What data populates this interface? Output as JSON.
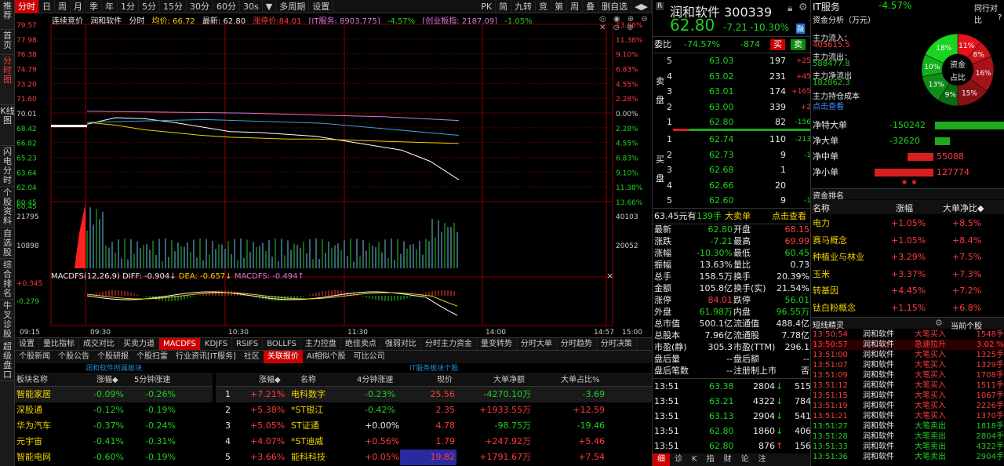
{
  "leftnav": [
    "推荐",
    "首页",
    "分时图",
    "K线图",
    "闪电分时",
    "个股资料",
    "自选股",
    "综合排名",
    "牛叉诊股",
    "超级盘口"
  ],
  "toolbar": {
    "items": [
      "分时",
      "日",
      "周",
      "月",
      "季",
      "年",
      "1分",
      "5分",
      "15分",
      "30分",
      "60分",
      "30s",
      "▼",
      "多周期",
      "设置"
    ],
    "right": [
      "PK",
      "简",
      "九转",
      "竞",
      "第",
      "周",
      "叠",
      "删自选",
      "◀▶"
    ]
  },
  "chart": {
    "header": {
      "mode": "连续竞价",
      "name": "润和软件",
      "type": "分时",
      "avg": "均价: 66.72",
      "last": "最新: 62.80",
      "limit": "涨停价:84.01",
      "index1": "[IT服务: 8903.775]",
      "index1_chg": "-4.57%",
      "index2": "[创业板指: 2187.09]",
      "index2_chg": "-1.05%"
    },
    "price_left": [
      "79.57",
      "77.98",
      "76.38",
      "74.79",
      "73.20",
      "71.60",
      "70.01",
      "68.42",
      "66.82",
      "65.23",
      "63.64",
      "62.04",
      "60.45"
    ],
    "pct_right": [
      "13.66%",
      "11.38%",
      "9.10%",
      "6.83%",
      "4.55%",
      "2.28%",
      "0.00%",
      "2.28%",
      "4.55%",
      "6.83%",
      "9.10%",
      "11.38%",
      "13.66%"
    ],
    "vol_left": [
      "21795",
      "10898"
    ],
    "vol_right": [
      "40103",
      "20052"
    ],
    "macd": {
      "label": "MACDFS(12,26,9)",
      "diff": "DIFF: -0.904↓",
      "dea": "DEA: -0.657↓",
      "macd": "MACDFS: -0.494↑",
      "top": "+0.345",
      "mid": "-0.279"
    },
    "times": [
      "09:15",
      "09:30",
      "10:30",
      "11:30",
      "14:00",
      "14:57",
      "15:00"
    ],
    "close_icon": "×"
  },
  "btabs": [
    "设置",
    "量比指标",
    "成交对比",
    "买卖力道",
    "MACDFS",
    "KDJFS",
    "RSIFS",
    "BOLLFS",
    "主力控盘",
    "绝佳卖点",
    "强弱对比",
    "分时主力资金",
    "量变转势",
    "分时大单",
    "分时趋势",
    "分时决策"
  ],
  "subtabs": [
    "个股新闻",
    "个股公告",
    "个股研报",
    "个股扫雷",
    "行业资讯[IT服务]",
    "社区",
    "关联报价",
    "AI相似个股",
    "可比公司"
  ],
  "sectorTable": {
    "title": "润和软件所属板块",
    "headers": [
      "板块名称",
      "涨幅◆",
      "5分钟涨速"
    ],
    "rows": [
      {
        "name": "智能家居",
        "chg": "-0.09%",
        "spd": "-0.26%"
      },
      {
        "name": "深股通",
        "chg": "-0.12%",
        "spd": "-0.19%"
      },
      {
        "name": "华为汽车",
        "chg": "-0.37%",
        "spd": "-0.24%"
      },
      {
        "name": "元宇宙",
        "chg": "-0.41%",
        "spd": "-0.31%"
      },
      {
        "name": "智能电网",
        "chg": "-0.60%",
        "spd": "-0.19%"
      }
    ]
  },
  "stockTable": {
    "title": "IT服务板块个股",
    "headers": [
      "涨幅◆",
      "名称",
      "4分钟涨速",
      "现价",
      "大单净额",
      "大单占比%"
    ],
    "rows": [
      {
        "no": "1",
        "chg": "+7.21%",
        "name": "电科数字",
        "spd": "-0.23%",
        "price": "25.56",
        "net": "-4270.10万",
        "ratio": "-3.69"
      },
      {
        "no": "2",
        "chg": "+5.38%",
        "name": "*ST银江",
        "spd": "-0.42%",
        "price": "2.35",
        "net": "+1933.55万",
        "ratio": "+12.59"
      },
      {
        "no": "3",
        "chg": "+5.05%",
        "name": "ST证通",
        "spd": "+0.00%",
        "price": "4.78",
        "net": "-98.75万",
        "ratio": "-19.46"
      },
      {
        "no": "4",
        "chg": "+4.07%",
        "name": "*ST迪威",
        "spd": "+0.56%",
        "price": "1.79",
        "net": "+247.92万",
        "ratio": "+5.46"
      },
      {
        "no": "5",
        "chg": "+3.66%",
        "name": "能科科技",
        "spd": "+0.05%",
        "price": "19.82",
        "net": "+1791.67万",
        "ratio": "+7.54"
      }
    ]
  },
  "quote": {
    "title": "润和软件 300339",
    "price": "62.80",
    "chg": "-7.21",
    "pct": "-10.30%",
    "tag": "融",
    "weibi": {
      "label": "委比",
      "pct": "-74.57%",
      "diff": "-874",
      "buy": "买",
      "sell": "卖"
    },
    "sell": [
      {
        "lv": "5",
        "p": "63.03",
        "v": "197",
        "d": "+25"
      },
      {
        "lv": "4",
        "p": "63.02",
        "v": "231",
        "d": "+45"
      },
      {
        "lv": "3",
        "p": "63.01",
        "v": "174",
        "d": "+165"
      },
      {
        "lv": "2",
        "p": "63.00",
        "v": "339",
        "d": "+2"
      },
      {
        "lv": "1",
        "p": "62.80",
        "v": "82",
        "d": "-156"
      }
    ],
    "buy": [
      {
        "lv": "1",
        "p": "62.74",
        "v": "110",
        "d": "-213"
      },
      {
        "lv": "2",
        "p": "62.73",
        "v": "9",
        "d": "-1"
      },
      {
        "lv": "3",
        "p": "62.68",
        "v": "1",
        "d": ""
      },
      {
        "lv": "4",
        "p": "62.66",
        "v": "20",
        "d": ""
      },
      {
        "lv": "5",
        "p": "62.60",
        "v": "9",
        "d": "-1"
      }
    ],
    "sell_label": "卖盘",
    "buy_label": "买盘",
    "bigorder": {
      "amt": "63.45元有",
      "vol": "139手",
      "type": "大卖单",
      "link": "点击查看"
    },
    "stats": [
      [
        "最新",
        "62.80",
        "开盘",
        "68.15"
      ],
      [
        "涨跌",
        "-7.21",
        "最高",
        "69.99"
      ],
      [
        "涨幅",
        "-10.30%",
        "最低",
        "60.45"
      ],
      [
        "振幅",
        "13.63%",
        "量比",
        "0.73"
      ],
      [
        "总手",
        "158.5万",
        "换手",
        "20.39%"
      ],
      [
        "金额",
        "105.8亿",
        "换手(实)",
        "21.54%"
      ],
      [
        "涨停",
        "84.01",
        "跌停",
        "56.01"
      ],
      [
        "外盘",
        "61.98万",
        "内盘",
        "96.55万"
      ],
      [
        "总市值",
        "500.1亿",
        "流通值",
        "488.4亿"
      ],
      [
        "总股本",
        "7.96亿",
        "流通股",
        "7.78亿"
      ],
      [
        "市盈(静)",
        "305.3",
        "市盈(TTM)",
        "296.1"
      ],
      [
        "盘后量",
        "--",
        "盘后额",
        "--"
      ],
      [
        "盘后笔数",
        "--",
        "注册制上市",
        "否"
      ]
    ],
    "ticks": [
      {
        "t": "13:51",
        "p": "63.38",
        "v": "2804",
        "a": "↓",
        "n": "515"
      },
      {
        "t": "13:51",
        "p": "63.21",
        "v": "4322",
        "a": "↓",
        "n": "784"
      },
      {
        "t": "13:51",
        "p": "63.13",
        "v": "2904",
        "a": "↓",
        "n": "541"
      },
      {
        "t": "13:51",
        "p": "62.80",
        "v": "1860",
        "a": "↓",
        "n": "406"
      },
      {
        "t": "13:51",
        "p": "62.80",
        "v": "876",
        "a": "↑",
        "n": "156"
      }
    ],
    "bottom_tabs": [
      "细",
      "诊",
      "K",
      "指",
      "财",
      "论",
      "注"
    ]
  },
  "funds": {
    "sector": "IT服务",
    "sector_chg": "-4.57%",
    "compare": "同行对比",
    "analysis_title": "资金分析（万元）",
    "help": "?",
    "inflow_label": "主力流入：",
    "inflow": "405615.5",
    "outflow_label": "主力流出：",
    "outflow": "588477.8",
    "net_label": "主力净流出",
    "net": "182862.3",
    "cost_label": "主力持仓成本",
    "cost_link": "点击查看",
    "pie": {
      "center1": "资金",
      "center2": "占比",
      "slices": [
        {
          "label": "11%",
          "value": 11,
          "color": "#e8121a"
        },
        {
          "label": "8%",
          "value": 8,
          "color": "#c81418"
        },
        {
          "label": "16%",
          "value": 16,
          "color": "#a51318"
        },
        {
          "label": "15%",
          "value": 15,
          "color": "#861216"
        },
        {
          "label": "9%",
          "value": 9,
          "color": "#0b6a12"
        },
        {
          "label": "13%",
          "value": 13,
          "color": "#0f8d17"
        },
        {
          "label": "10%",
          "value": 10,
          "color": "#12b11d"
        },
        {
          "label": "18%",
          "value": 18,
          "color": "#1bd321"
        }
      ]
    },
    "flows": [
      {
        "label": "净特大单",
        "value": "-150242",
        "frac": 1.0,
        "color": "#1fa81f"
      },
      {
        "label": "净大单",
        "value": "-32620",
        "frac": 0.22,
        "color": "#1fa81f"
      },
      {
        "label": "净中单",
        "value": "55088",
        "frac": 0.37,
        "color": "#d61f1f"
      },
      {
        "label": "净小单",
        "value": "127774",
        "frac": 0.85,
        "color": "#d61f1f"
      }
    ],
    "rank_title": "资金排名",
    "rank_headers": [
      "名称",
      "涨幅",
      "大单净比◆"
    ],
    "rank": [
      {
        "name": "电力",
        "chg": "+1.05%",
        "ratio": "+8.5%"
      },
      {
        "name": "赛马概念",
        "chg": "+1.05%",
        "ratio": "+8.4%"
      },
      {
        "name": "种植业与林业",
        "chg": "+3.29%",
        "ratio": "+7.5%"
      },
      {
        "name": "玉米",
        "chg": "+3.37%",
        "ratio": "+7.3%"
      },
      {
        "name": "转基因",
        "chg": "+4.45%",
        "ratio": "+7.2%"
      },
      {
        "name": "钛白粉概念",
        "chg": "+1.15%",
        "ratio": "+6.8%"
      }
    ],
    "spirit_title": "短线精灵",
    "spirit_scope": "当前个股",
    "spirit": [
      {
        "t": "13:50:54",
        "name": "润和软件",
        "act": "大笔买入",
        "val": "1548手",
        "red": true
      },
      {
        "t": "13:50:57",
        "name": "润和软件",
        "act": "急速拉升",
        "val": "3.02 %",
        "red": true,
        "hl": true
      },
      {
        "t": "13:51:00",
        "name": "润和软件",
        "act": "大笔买入",
        "val": "1325手",
        "red": true
      },
      {
        "t": "13:51:07",
        "name": "润和软件",
        "act": "大笔买入",
        "val": "1329手",
        "red": true
      },
      {
        "t": "13:51:09",
        "name": "润和软件",
        "act": "大笔买入",
        "val": "1708手",
        "red": true
      },
      {
        "t": "13:51:12",
        "name": "润和软件",
        "act": "大笔买入",
        "val": "1511手",
        "red": true
      },
      {
        "t": "13:51:15",
        "name": "润和软件",
        "act": "大笔买入",
        "val": "1067手",
        "red": true
      },
      {
        "t": "13:51:19",
        "name": "润和软件",
        "act": "大笔买入",
        "val": "2226手",
        "red": true
      },
      {
        "t": "13:51:21",
        "name": "润和软件",
        "act": "大笔买入",
        "val": "1370手",
        "red": true
      },
      {
        "t": "13:51:27",
        "name": "润和软件",
        "act": "大笔卖出",
        "val": "1818手",
        "red": false
      },
      {
        "t": "13:51:28",
        "name": "润和软件",
        "act": "大笔卖出",
        "val": "2804手",
        "red": false
      },
      {
        "t": "13:51:33",
        "name": "润和软件",
        "act": "大笔卖出",
        "val": "4322手",
        "red": false
      },
      {
        "t": "13:51:36",
        "name": "润和软件",
        "act": "大笔卖出",
        "val": "2904手",
        "red": false
      }
    ]
  },
  "chart_data": {
    "type": "line",
    "title": "",
    "xlabel": "",
    "ylabel": "",
    "ylim": [
      60.45,
      79.57
    ],
    "x": [
      "09:30",
      "09:45",
      "10:00",
      "10:15",
      "10:30",
      "10:45",
      "11:00",
      "11:15",
      "11:30",
      "13:00",
      "13:15",
      "13:30",
      "13:45",
      "13:51"
    ],
    "series": [
      {
        "name": "最新",
        "values": [
          68.8,
          69.5,
          69.4,
          69.0,
          68.5,
          68.0,
          67.9,
          67.7,
          67.5,
          67.0,
          66.5,
          66.0,
          64.8,
          62.8
        ]
      },
      {
        "name": "均价",
        "values": [
          69.0,
          68.7,
          68.2,
          67.9,
          67.6,
          67.4,
          67.3,
          67.2,
          67.2,
          67.1,
          67.0,
          66.9,
          66.8,
          66.72
        ]
      }
    ]
  }
}
